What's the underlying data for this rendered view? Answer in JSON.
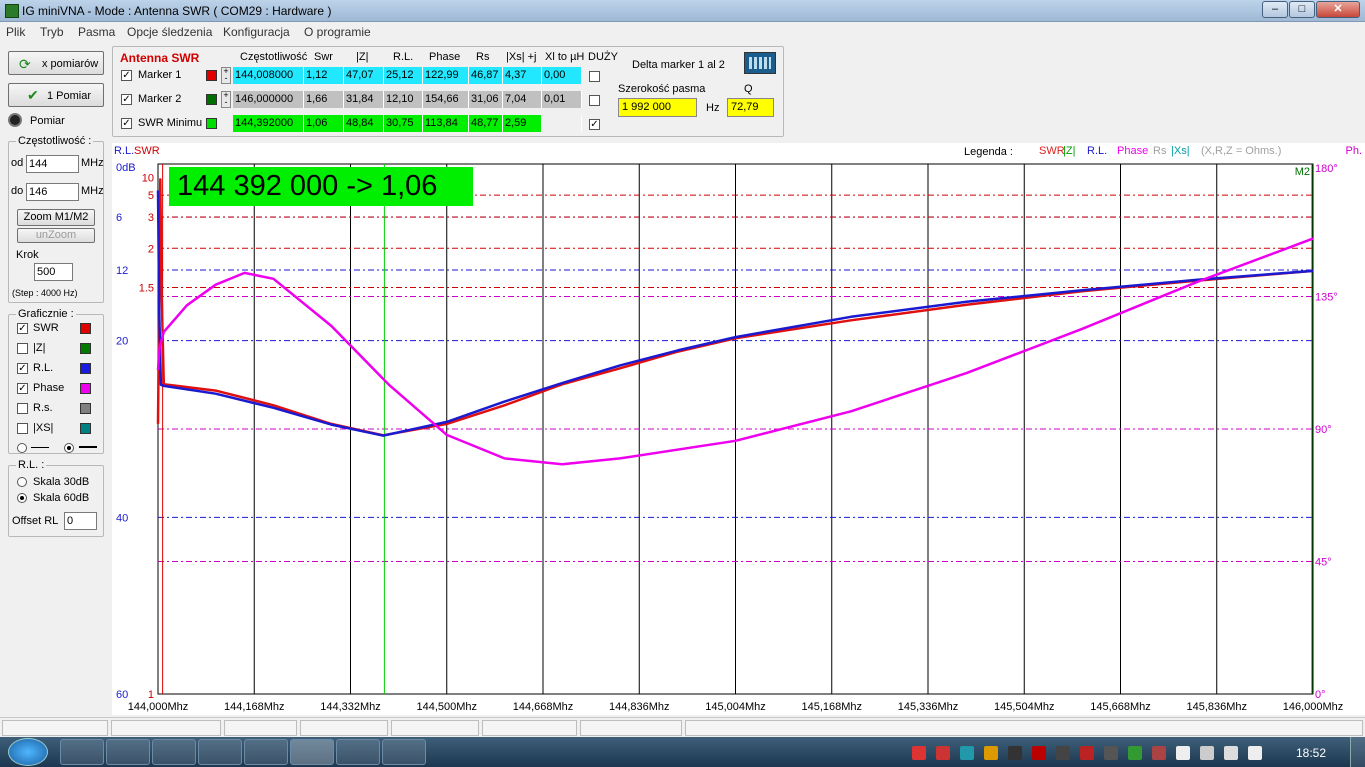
{
  "window": {
    "title": "IG miniVNA - Mode : Antenna SWR ( COM29 :  Hardware )"
  },
  "menu": [
    "Plik",
    "Tryb",
    "Pasma",
    "Opcje śledzenia",
    "Konfiguracja",
    "O programie"
  ],
  "left": {
    "multi_btn": "x pomiarów",
    "single_btn": "1 Pomiar",
    "pomiar": "Pomiar",
    "freq_group": "Częstotliwość :",
    "from_label": "od",
    "from_value": "144",
    "to_label": "do",
    "to_value": "146",
    "mhz": "MHz",
    "zoom": "Zoom M1/M2",
    "unzoom": "unZoom",
    "step_label": "Krok",
    "step_value": "500",
    "step_info": "(Step : 4000 Hz)",
    "graph_group": "Graficznie :",
    "graph_items": [
      {
        "label": "SWR",
        "checked": true,
        "color": "#e00000"
      },
      {
        "label": "|Z|",
        "checked": false,
        "color": "#007a00"
      },
      {
        "label": "R.L.",
        "checked": true,
        "color": "#1a1ae0"
      },
      {
        "label": "Phase",
        "checked": true,
        "color": "#ee00ee"
      },
      {
        "label": "R.s.",
        "checked": false,
        "color": "#808080"
      },
      {
        "label": "|XS|",
        "checked": false,
        "color": "#008080"
      }
    ],
    "rl_group": "R.L. :",
    "scale30": "Skala 30dB",
    "scale60": "Skala 60dB",
    "offset_label": "Offset RL",
    "offset_value": "0"
  },
  "markers": {
    "title": "Antenna SWR",
    "headers": [
      "Częstotliwość",
      "Swr",
      "|Z|",
      "R.L.",
      "Phase",
      "Rs",
      "|Xs| +j",
      "Xl to µH",
      "DUŻY"
    ],
    "rows": [
      {
        "name": "Marker 1",
        "color": "#e00000",
        "bg": "#22e8ff",
        "values": [
          "144,008000",
          "1,12",
          "47,07",
          "25,12",
          "122,99",
          "46,87",
          "4,37",
          "0,00"
        ]
      },
      {
        "name": "Marker 2",
        "color": "#006f00",
        "bg": "#c0c0c0",
        "values": [
          "146,000000",
          "1,66",
          "31,84",
          "12,10",
          "154,66",
          "31,06",
          "7,04",
          "0,01"
        ]
      },
      {
        "name": "SWR Minimu",
        "color": "#00dd00",
        "bg": "#00ee00",
        "values": [
          "144,392000",
          "1,06",
          "48,84",
          "30,75",
          "113,84",
          "48,77",
          "2,59",
          ""
        ]
      }
    ],
    "delta_label": "Delta marker 1 al 2",
    "bw_label": "Szerokość pasma",
    "bw_value": "1 992 000",
    "hz": "Hz",
    "q_label": "Q",
    "q_value": "72,79"
  },
  "chart_data": {
    "type": "line",
    "readout": "144 392 000 -> 1,06",
    "legend_label": "Legenda :",
    "legend_items": [
      {
        "label": "SWR",
        "color": "#e02020"
      },
      {
        "label": "|Z|",
        "color": "#00a000"
      },
      {
        "label": "R.L.",
        "color": "#1a1ad0"
      },
      {
        "label": "Phase",
        "color": "#ee00ee"
      },
      {
        "label": "Rs",
        "color": "#a0a0a0"
      },
      {
        "label": "|Xs|",
        "color": "#00a0a0"
      },
      {
        "label": "(X,R,Z = Ohms.)",
        "color": "#a0a0a0"
      }
    ],
    "axis_rl_title": "R.L.",
    "axis_swr_title": "SWR",
    "axis_phase_title": "Ph.",
    "x_ticks": [
      "144,000Mhz",
      "144,168Mhz",
      "144,332Mhz",
      "144,500Mhz",
      "144,668Mhz",
      "144,836Mhz",
      "145,004Mhz",
      "145,168Mhz",
      "145,336Mhz",
      "145,504Mhz",
      "145,668Mhz",
      "145,836Mhz",
      "146,000Mhz"
    ],
    "rl_ticks": [
      "0dB",
      "6",
      "12",
      "20",
      "40",
      "60"
    ],
    "swr_ticks": [
      "10",
      "5",
      "3",
      "2",
      "1.5",
      "1"
    ],
    "phase_ticks": [
      "180°",
      "135°",
      "90°",
      "45°",
      "0°"
    ],
    "m2_label": "M2",
    "xlim": [
      144.0,
      146.0
    ],
    "rl_ylim": [
      0,
      60
    ],
    "phase_ylim": [
      0,
      180
    ],
    "series": [
      {
        "name": "SWR",
        "color": "#e01010",
        "x": [
          144.0,
          144.004,
          144.006,
          144.01,
          144.1,
          144.2,
          144.3,
          144.39,
          144.5,
          144.6,
          144.7,
          144.8,
          144.9,
          145.0,
          145.2,
          145.4,
          145.6,
          145.8,
          146.0
        ],
        "y": [
          1.07,
          10.0,
          1.5,
          1.12,
          1.11,
          1.09,
          1.07,
          1.06,
          1.07,
          1.09,
          1.12,
          1.15,
          1.19,
          1.23,
          1.3,
          1.38,
          1.47,
          1.56,
          1.66
        ]
      },
      {
        "name": "R.L.",
        "color": "#1a1ad0",
        "x": [
          144.0,
          144.002,
          144.005,
          144.01,
          144.1,
          144.2,
          144.3,
          144.39,
          144.5,
          144.6,
          144.7,
          144.8,
          144.9,
          145.0,
          145.2,
          145.4,
          145.6,
          145.8,
          146.0
        ],
        "y": [
          3.0,
          16.5,
          25.0,
          25.12,
          26.0,
          27.6,
          29.5,
          30.75,
          29.2,
          26.9,
          24.8,
          22.8,
          21.1,
          19.6,
          17.3,
          15.6,
          14.3,
          13.1,
          12.1
        ]
      },
      {
        "name": "Phase",
        "color": "#ee00ee",
        "x": [
          144.0,
          144.003,
          144.01,
          144.05,
          144.1,
          144.15,
          144.2,
          144.3,
          144.4,
          144.5,
          144.6,
          144.7,
          144.8,
          145.0,
          145.2,
          145.4,
          145.6,
          145.8,
          146.0
        ],
        "y": [
          110.0,
          118.0,
          122.99,
          132.0,
          139.0,
          143.0,
          141.0,
          125.0,
          105.0,
          88.0,
          80.0,
          78.0,
          80.0,
          86.0,
          96.0,
          109.0,
          124.0,
          140.0,
          154.66
        ]
      }
    ]
  },
  "status": [
    "",
    "",
    "",
    "",
    "",
    "",
    "",
    ""
  ],
  "taskbar": {
    "clock": "18:52"
  }
}
